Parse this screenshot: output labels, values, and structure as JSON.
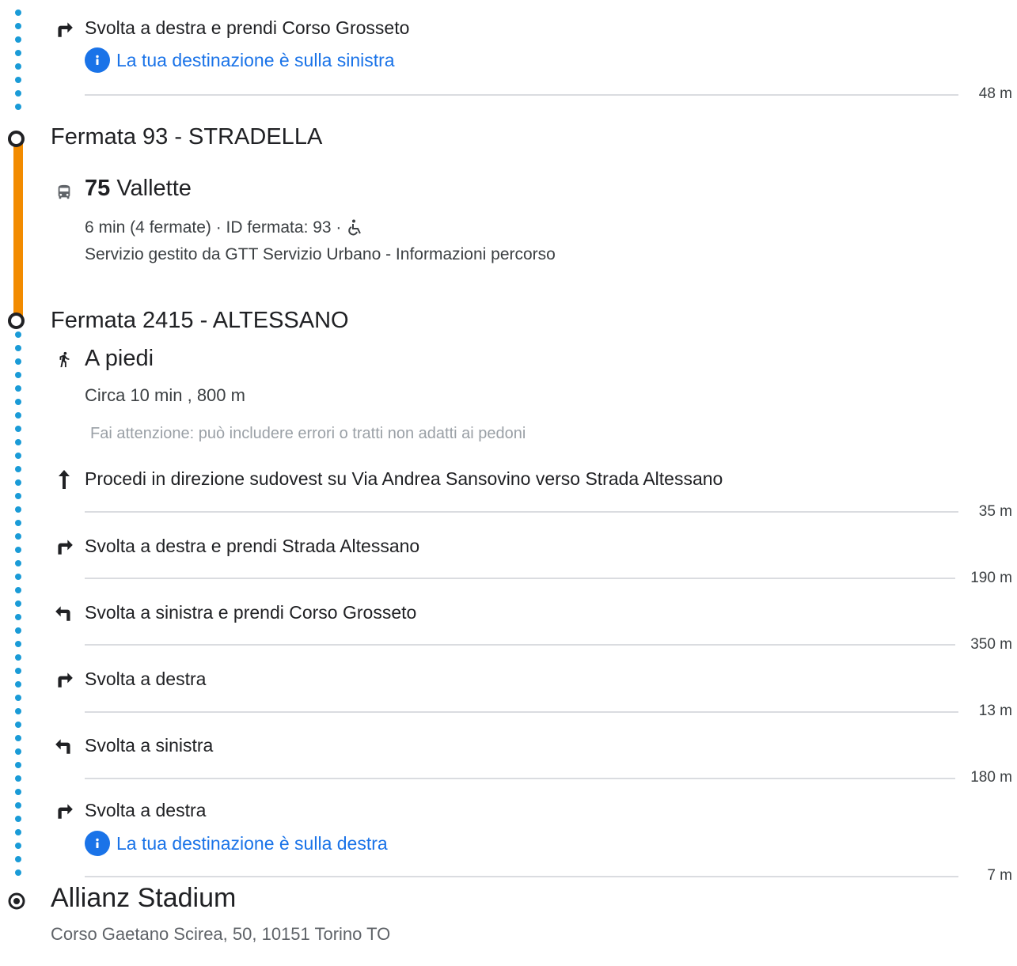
{
  "colors": {
    "walk_dot": "#1a9bd7",
    "transit_line": "#f28b00",
    "link": "#1a73e8",
    "divider": "#dadce0"
  },
  "walk1": {
    "turn_step": {
      "icon": "turn-right-icon",
      "text": "Svolta a destra e prendi Corso Grosseto"
    },
    "destination_info": {
      "icon": "info-icon",
      "text": "La tua destinazione è sulla sinistra"
    },
    "distance": "48 m"
  },
  "stop_from": {
    "name": "Fermata 93 - STRADELLA"
  },
  "transit": {
    "icon": "bus-icon",
    "line_number": "75",
    "line_destination": "Vallette",
    "details": "6 min (4 fermate) · ID fermata: 93 ·",
    "accessibility_icon": "wheelchair-icon",
    "operator": "Servizio gestito da GTT Servizio Urbano - Informazioni percorso"
  },
  "stop_to": {
    "name": "Fermata 2415 - ALTESSANO"
  },
  "walk2": {
    "icon": "walk-icon",
    "title": "A piedi",
    "summary": "Circa 10 min , 800 m",
    "warning": "Fai attenzione: può includere errori o tratti non adatti ai pedoni",
    "steps": [
      {
        "icon": "straight-arrow-icon",
        "text": "Procedi in direzione sudovest su Via Andrea Sansovino verso Strada Altessano",
        "distance": "35 m"
      },
      {
        "icon": "turn-right-icon",
        "text": "Svolta a destra e prendi Strada Altessano",
        "distance": "190 m"
      },
      {
        "icon": "turn-left-icon",
        "text": "Svolta a sinistra e prendi Corso Grosseto",
        "distance": "350 m"
      },
      {
        "icon": "turn-right-icon",
        "text": "Svolta a destra",
        "distance": "13 m"
      },
      {
        "icon": "turn-left-icon",
        "text": "Svolta a sinistra",
        "distance": "180 m"
      },
      {
        "icon": "turn-right-icon",
        "text": "Svolta a destra",
        "distance": "7 m"
      }
    ],
    "destination_info": {
      "icon": "info-icon",
      "text": "La tua destinazione è sulla destra"
    }
  },
  "destination": {
    "icon": "destination-marker-icon",
    "name": "Allianz Stadium",
    "address": "Corso Gaetano Scirea, 50, 10151 Torino TO"
  }
}
